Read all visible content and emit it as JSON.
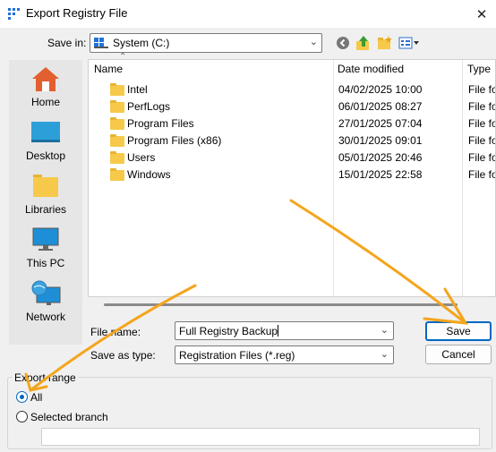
{
  "window": {
    "title": "Export Registry File",
    "close_glyph": "✕"
  },
  "save_in": {
    "label": "Save in:",
    "value": "System (C:)"
  },
  "places": [
    {
      "label": "Home",
      "icon": "home-icon"
    },
    {
      "label": "Desktop",
      "icon": "desktop-icon"
    },
    {
      "label": "Libraries",
      "icon": "libraries-icon"
    },
    {
      "label": "This PC",
      "icon": "this-pc-icon"
    },
    {
      "label": "Network",
      "icon": "network-icon"
    }
  ],
  "file_list": {
    "columns": {
      "name": "Name",
      "date": "Date modified",
      "type": "Type"
    },
    "rows": [
      {
        "name": "Intel",
        "date": "04/02/2025 10:00",
        "type": "File fo"
      },
      {
        "name": "PerfLogs",
        "date": "06/01/2025 08:27",
        "type": "File fo"
      },
      {
        "name": "Program Files",
        "date": "27/01/2025 07:04",
        "type": "File fo"
      },
      {
        "name": "Program Files (x86)",
        "date": "30/01/2025 09:01",
        "type": "File fo"
      },
      {
        "name": "Users",
        "date": "05/01/2025 20:46",
        "type": "File fo"
      },
      {
        "name": "Windows",
        "date": "15/01/2025 22:58",
        "type": "File fo"
      }
    ]
  },
  "file_name": {
    "label": "File name:",
    "value": "Full Registry Backup"
  },
  "save_as_type": {
    "label": "Save as type:",
    "value": "Registration Files (*.reg)"
  },
  "buttons": {
    "save": "Save",
    "cancel": "Cancel"
  },
  "export_range": {
    "title": "Export range",
    "all_label": "All",
    "branch_label": "Selected branch",
    "branch_value": "",
    "selected": "All"
  },
  "colors": {
    "accent": "#0067c0",
    "annotation_arrow": "#f4a51c"
  }
}
